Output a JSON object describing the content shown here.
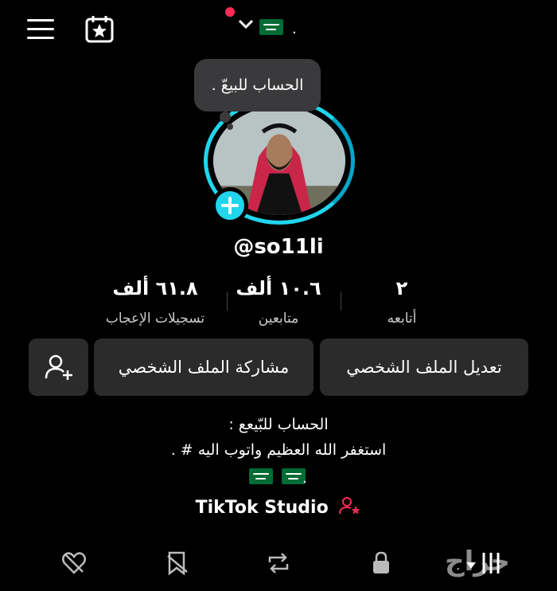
{
  "top_bar": {
    "menu_icon": "hamburger-menu-icon",
    "calendar_icon": "calendar-star-icon",
    "account_switch_icon": "chevron-down-icon",
    "flag": "saudi-flag",
    "dot": "."
  },
  "tooltip": {
    "text": "الحساب للبيعّ ."
  },
  "profile": {
    "username": "@so11li",
    "add_button_icon": "plus-icon"
  },
  "stats": [
    {
      "value": "٢",
      "label": "أتابعه"
    },
    {
      "value": "١٠.٦ ألف",
      "label": "متابعين"
    },
    {
      "value": "٦١.٨ ألف",
      "label": "تسجيلات الإعجاب"
    }
  ],
  "actions": {
    "edit_profile": "تعديل الملف الشخصي",
    "share_profile": "مشاركة الملف الشخصي",
    "add_friend_icon": "add-user-icon"
  },
  "bio": {
    "line1": "الحساب للبّيعع :",
    "line2": "استغفر الله العظيم واتوب اليه # .",
    "line3": "."
  },
  "studio": {
    "label": "TikTok Studio"
  },
  "tabs": [
    "grid-icon",
    "lock-icon",
    "repost-icon",
    "saved-icon",
    "liked-icon"
  ],
  "watermark": "حراج",
  "colors": {
    "accent_cyan": "#20d5ec",
    "accent_pink": "#fe2c55",
    "button_bg": "#2b2b2b"
  }
}
